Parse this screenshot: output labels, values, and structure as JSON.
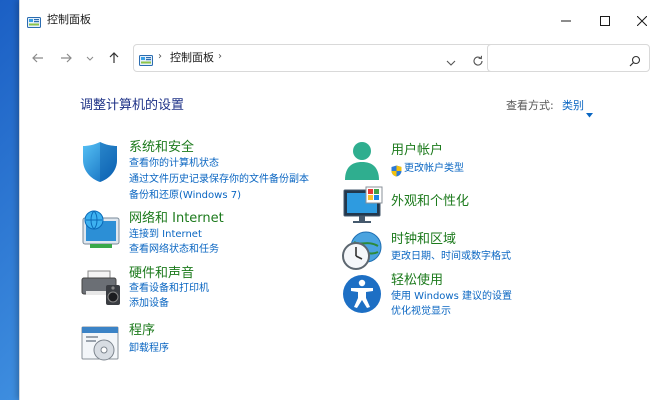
{
  "window": {
    "title": "控制面板",
    "colors": {
      "accent": "#0a66c2",
      "category_title": "#1c7a1c",
      "page_title": "#1e3287"
    }
  },
  "address": {
    "separator": "›",
    "path": "控制面板",
    "search_placeholder": ""
  },
  "content": {
    "page_title": "调整计算机的设置",
    "view_by_label": "查看方式:",
    "view_by_value": "类别"
  },
  "categories": [
    {
      "title": "系统和安全",
      "icon": "system-security-shield-icon",
      "links": [
        "查看你的计算机状态",
        "通过文件历史记录保存你的文件备份副本",
        "备份和还原(Windows 7)"
      ]
    },
    {
      "title": "网络和 Internet",
      "icon": "network-globe-icon",
      "links": [
        "连接到 Internet",
        "查看网络状态和任务"
      ]
    },
    {
      "title": "硬件和声音",
      "icon": "printer-speaker-icon",
      "links": [
        "查看设备和打印机",
        "添加设备"
      ]
    },
    {
      "title": "程序",
      "icon": "programs-disc-icon",
      "links": [
        "卸载程序"
      ]
    },
    {
      "title": "用户帐户",
      "icon": "user-accounts-icon",
      "links": [
        "更改帐户类型"
      ]
    },
    {
      "title": "外观和个性化",
      "icon": "appearance-monitor-icon",
      "links": []
    },
    {
      "title": "时钟和区域",
      "icon": "clock-region-icon",
      "links": [
        "更改日期、时间或数字格式"
      ]
    },
    {
      "title": "轻松使用",
      "icon": "ease-of-access-icon",
      "links": [
        "使用 Windows 建议的设置",
        "优化视觉显示"
      ]
    }
  ]
}
